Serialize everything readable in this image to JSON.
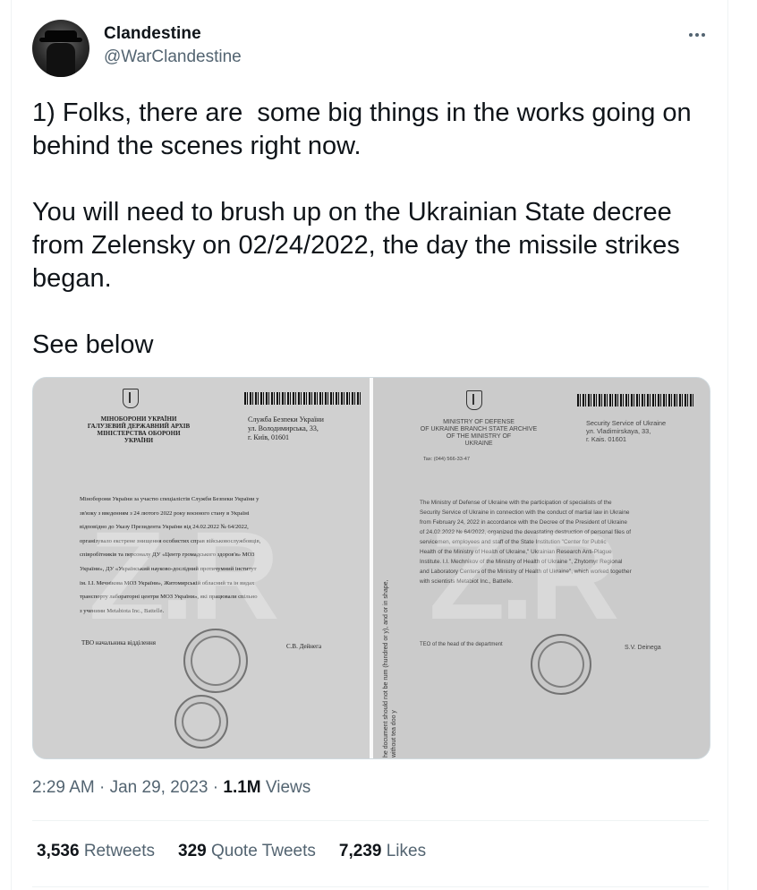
{
  "user": {
    "display_name": "Clandestine",
    "handle": "@WarClandestine"
  },
  "tweet": {
    "text": "1) Folks, there are  some big things in the works going on behind the scenes right now.\n\nYou will need to brush up on the Ukrainian State decree from Zelensky on 02/24/2022, the day the missile strikes began.\n\nSee below",
    "time": "2:29 AM",
    "date": "Jan 29, 2023",
    "views_count": "1.1M",
    "views_label": "Views"
  },
  "media": {
    "left_doc": {
      "header_lines": [
        "МІНОБОРОНИ УКРАЇНИ",
        "ГАЛУЗЕВИЙ ДЕРЖАВНИЙ АРХІВ",
        "МІНІСТЕРСТВА ОБОРОНИ",
        "УКРАЇНИ"
      ],
      "address_lines": [
        "Служба Безпеки України",
        "ул. Володимирська, 33,",
        "г. Київ, 01601"
      ],
      "body_lines": [
        "Міноборони України за участю спеціалістів Служби Безпеки України у",
        "зв'язку з введенням з 24 лютого 2022 року воєнного стану в Україні",
        "відповідно до Указу Президента України від 24.02.2022 № 64/2022,",
        "організувало екстрене знищення особистих справ військовослужбовців,",
        "співробітників та персоналу ДУ «Центр громадського здоров'я» МОЗ",
        "України», ДУ «Український науково-дослідний протичумний інститут",
        "ім. І.І. Мечнікова МОЗ України», Житомирській обласний та ін видах",
        "транспорту лабораторні центри МОЗ України», які працювали спільно",
        "з ученими Metabiota Inc., Battelle."
      ],
      "signoff": "ТВО начальника відділення",
      "signature": "С.В. Дейнега"
    },
    "right_doc": {
      "header_lines": [
        "MINISTRY OF DEFENSE",
        "OF UKRAINE BRANCH STATE ARCHIVE",
        "OF THE MINISTRY OF",
        "UKRAINE"
      ],
      "phone": "Tax: (044) 566-33-47",
      "address_lines": [
        "Security Service of Ukraine",
        "ул. Vladimirskaya, 33,",
        "г. Kais. 01601"
      ],
      "body_lines": [
        "The Ministry of Defense of Ukraine with the participation of specialists of the",
        "Security Service of Ukraine in connection with the conduct of martial law in Ukraine",
        "from February 24, 2022 in accordance with the Decree of the President of Ukraine",
        "of 24.02.2022 № 64/2022, organized the devastating destruction of personal files of",
        "servicemen, employees and staff of the State Institution \"Center for Public",
        "Health of the Ministry of Health of Ukraine,\" Ukrainian Research Anti-Plague",
        "Institute. I.I. Mechnikov of the Ministry of Health of Ukraine \", Zhytomyr Regional",
        "and Laboratory Centers of the Ministry of Health of Ukraine\", which worked together",
        "with scientists Metabiot Inc., Battelle."
      ],
      "signoff": "TEO of the head of the department",
      "signature": "S.V. Deinega",
      "side_note": "he document should not be rum (hundred or y), and or in shape, without tea doo y"
    },
    "watermark": "Z.R"
  },
  "stats": {
    "retweets_count": "3,536",
    "retweets_label": "Retweets",
    "quotes_count": "329",
    "quotes_label": "Quote Tweets",
    "likes_count": "7,239",
    "likes_label": "Likes"
  }
}
